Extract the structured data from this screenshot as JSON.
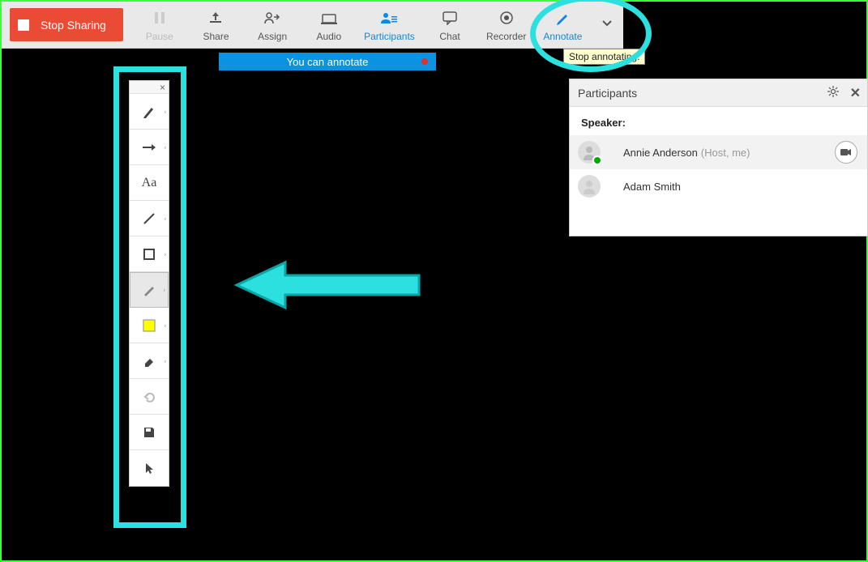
{
  "toolbar": {
    "stop_sharing": "Stop Sharing",
    "items": [
      {
        "key": "pause",
        "label": "Pause",
        "disabled": true
      },
      {
        "key": "share",
        "label": "Share"
      },
      {
        "key": "assign",
        "label": "Assign"
      },
      {
        "key": "audio",
        "label": "Audio"
      },
      {
        "key": "participants",
        "label": "Participants",
        "active": true
      },
      {
        "key": "chat",
        "label": "Chat"
      },
      {
        "key": "recorder",
        "label": "Recorder"
      },
      {
        "key": "annotate",
        "label": "Annotate",
        "active": true
      }
    ]
  },
  "annotate_banner": "You can annotate",
  "tooltip": "Stop annotating.",
  "anno_tools": [
    {
      "key": "pen",
      "has_sub": true
    },
    {
      "key": "arrow",
      "has_sub": true
    },
    {
      "key": "text",
      "label": "Aa"
    },
    {
      "key": "line",
      "has_sub": true
    },
    {
      "key": "rect",
      "has_sub": true
    },
    {
      "key": "highlighter",
      "has_sub": true,
      "selected": true
    },
    {
      "key": "color",
      "has_sub": true,
      "color": "#ffff00"
    },
    {
      "key": "eraser",
      "has_sub": true
    },
    {
      "key": "undo"
    },
    {
      "key": "save"
    },
    {
      "key": "pointer"
    }
  ],
  "participants": {
    "title": "Participants",
    "speaker_label": "Speaker:",
    "list": [
      {
        "name": "Annie Anderson",
        "sub": "(Host, me)",
        "highlight": true,
        "camera": true,
        "presence": true
      },
      {
        "name": "Adam Smith"
      }
    ]
  }
}
